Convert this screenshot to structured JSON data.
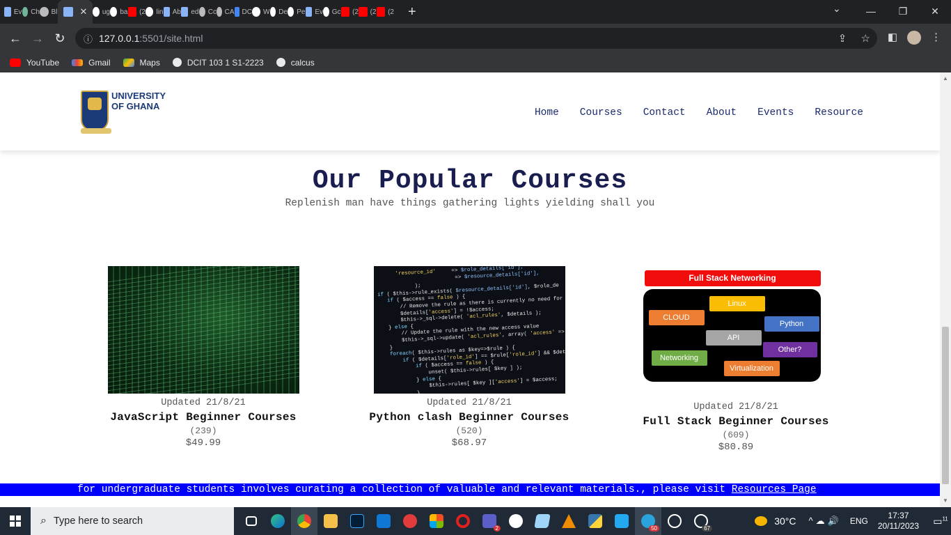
{
  "browser": {
    "tabs": [
      {
        "title": "Ev",
        "icon": "document-icon",
        "color": "#8ab4f8"
      },
      {
        "title": "Ch",
        "icon": "chatgpt-icon",
        "color": "#6fb59a"
      },
      {
        "title": "Bl",
        "icon": "globe-icon",
        "color": "#bbbbbb"
      },
      {
        "title": "",
        "icon": "document-icon",
        "color": "#8ab4f8",
        "active": true
      },
      {
        "title": "ug",
        "icon": "google-icon",
        "color": "#ffffff"
      },
      {
        "title": "ba",
        "icon": "google-icon",
        "color": "#ffffff"
      },
      {
        "title": "(2",
        "icon": "youtube-icon",
        "color": "#ff0000"
      },
      {
        "title": "lin",
        "icon": "google-icon",
        "color": "#ffffff"
      },
      {
        "title": "Ab",
        "icon": "document-icon",
        "color": "#8ab4f8"
      },
      {
        "title": "ed",
        "icon": "document-icon",
        "color": "#8ab4f8"
      },
      {
        "title": "Cc",
        "icon": "globe-icon",
        "color": "#bbbbbb"
      },
      {
        "title": "CA",
        "icon": "globe-icon",
        "color": "#bbbbbb"
      },
      {
        "title": "DC",
        "icon": "docs-icon",
        "color": "#4285f4"
      },
      {
        "title": "W",
        "icon": "github-icon",
        "color": "#ffffff"
      },
      {
        "title": "De",
        "icon": "github-icon",
        "color": "#ffffff"
      },
      {
        "title": "Pe",
        "icon": "github-icon",
        "color": "#ffffff"
      },
      {
        "title": "Ev",
        "icon": "document-icon",
        "color": "#8ab4f8"
      },
      {
        "title": "Gc",
        "icon": "google-icon",
        "color": "#ffffff"
      },
      {
        "title": "(2",
        "icon": "youtube-icon",
        "color": "#ff0000"
      },
      {
        "title": "(2",
        "icon": "youtube-icon",
        "color": "#ff0000"
      },
      {
        "title": "(2",
        "icon": "youtube-icon",
        "color": "#ff0000"
      }
    ],
    "url_host": "127.0.0.1",
    "url_path": ":5501/site.html",
    "bookmarks": [
      {
        "label": "YouTube",
        "icon": "youtube-icon"
      },
      {
        "label": "Gmail",
        "icon": "gmail-icon"
      },
      {
        "label": "Maps",
        "icon": "maps-icon"
      },
      {
        "label": "DCIT 103 1 S1-2223",
        "icon": "globe-icon"
      },
      {
        "label": "calcus",
        "icon": "globe-icon"
      }
    ]
  },
  "site": {
    "logo": {
      "line1": "UNIVERSITY",
      "line2": "OF GHANA"
    },
    "nav": [
      "Home",
      "Courses",
      "Contact",
      "About",
      "Events",
      "Resource"
    ],
    "section_title": "Our Popular Courses",
    "section_subtitle": "Replenish man have things gathering lights yielding shall you",
    "courses": [
      {
        "updated": "Updated 21/8/21",
        "name": "JavaScript Beginner Courses",
        "count": "(239)",
        "price": "$49.99"
      },
      {
        "updated": "Updated 21/8/21",
        "name": "Python clash Beginner Courses",
        "count": "(520)",
        "price": "$68.97"
      },
      {
        "updated": "Updated 21/8/21",
        "name": "Full Stack Beginner Courses",
        "count": "(609)",
        "price": "$80.89"
      }
    ],
    "fullstack_image": {
      "title": "Full Stack Networking",
      "chips": [
        "Linux",
        "CLOUD",
        "Python",
        "API",
        "Other?",
        "Networking",
        "Virtualization"
      ]
    },
    "banner_text": "for undergraduate students involves curating a collection of valuable and relevant materials., please visit ",
    "banner_link": "Resources Page"
  },
  "taskbar": {
    "search_placeholder": "Type here to search",
    "weather": "30°C",
    "language": "ENG",
    "time": "17:37",
    "date": "20/11/2023",
    "notifications": "11",
    "badges": {
      "teams": "2",
      "telegram": "50",
      "whatsapp": "67"
    }
  }
}
